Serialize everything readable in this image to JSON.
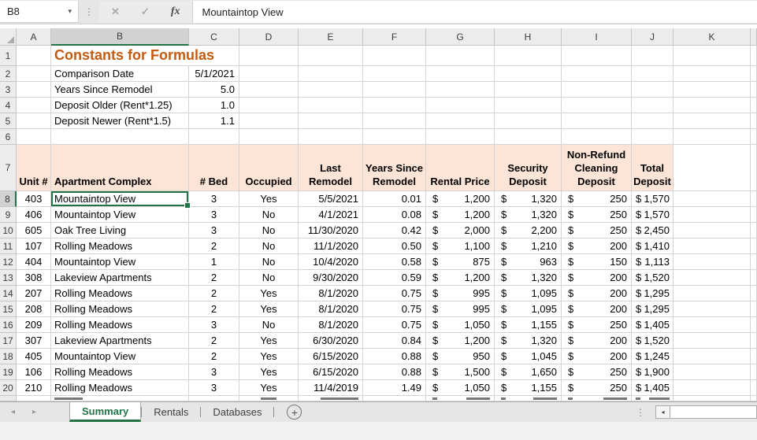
{
  "formula_bar": {
    "cell_reference": "B8",
    "formula": "Mountaintop View"
  },
  "icons": {
    "name_box_caret": "▾",
    "cancel": "✕",
    "confirm": "✓",
    "function": "fx",
    "tab_nav_left": "◂",
    "tab_nav_right": "▸",
    "add_sheet": "+",
    "more_dots": "⋮",
    "scroll_left": "◂"
  },
  "colors": {
    "accent_green": "#217346",
    "table_header_fill": "#FCE4D6",
    "title_text": "#C55A11",
    "chrome_gray": "#E6E6E6"
  },
  "column_headers": [
    "A",
    "B",
    "C",
    "D",
    "E",
    "F",
    "G",
    "H",
    "I",
    "J",
    "K"
  ],
  "selection": {
    "cell": "B8",
    "column": "B",
    "row": 8
  },
  "constants": {
    "title": "Constants for Formulas",
    "items": [
      {
        "row": 2,
        "label": "Comparison Date",
        "value": "5/1/2021"
      },
      {
        "row": 3,
        "label": "Years Since Remodel",
        "value": "5.0"
      },
      {
        "row": 4,
        "label": "Deposit Older (Rent*1.25)",
        "value": "1.0"
      },
      {
        "row": 5,
        "label": "Deposit Newer (Rent*1.5)",
        "value": "1.1"
      }
    ]
  },
  "table": {
    "header_row": 7,
    "headers": [
      "Unit #",
      "Apartment Complex",
      "# Bed",
      "Occupied",
      "Last Remodel",
      "Years Since Remodel",
      "Rental Price",
      "Security Deposit",
      "Non-Refund Cleaning Deposit",
      "Total Deposit"
    ],
    "currency_symbol": "$",
    "rows": [
      {
        "row": 8,
        "unit": "403",
        "complex": "Mountaintop View",
        "beds": "3",
        "occupied": "Yes",
        "last_remodel": "5/5/2021",
        "years_since": "0.01",
        "rental": "1,200",
        "security": "1,320",
        "cleaning": "250",
        "total": "1,570"
      },
      {
        "row": 9,
        "unit": "406",
        "complex": "Mountaintop View",
        "beds": "3",
        "occupied": "No",
        "last_remodel": "4/1/2021",
        "years_since": "0.08",
        "rental": "1,200",
        "security": "1,320",
        "cleaning": "250",
        "total": "1,570"
      },
      {
        "row": 10,
        "unit": "605",
        "complex": "Oak Tree Living",
        "beds": "3",
        "occupied": "No",
        "last_remodel": "11/30/2020",
        "years_since": "0.42",
        "rental": "2,000",
        "security": "2,200",
        "cleaning": "250",
        "total": "2,450"
      },
      {
        "row": 11,
        "unit": "107",
        "complex": "Rolling Meadows",
        "beds": "2",
        "occupied": "No",
        "last_remodel": "11/1/2020",
        "years_since": "0.50",
        "rental": "1,100",
        "security": "1,210",
        "cleaning": "200",
        "total": "1,410"
      },
      {
        "row": 12,
        "unit": "404",
        "complex": "Mountaintop View",
        "beds": "1",
        "occupied": "No",
        "last_remodel": "10/4/2020",
        "years_since": "0.58",
        "rental": "875",
        "security": "963",
        "cleaning": "150",
        "total": "1,113"
      },
      {
        "row": 13,
        "unit": "308",
        "complex": "Lakeview Apartments",
        "beds": "2",
        "occupied": "No",
        "last_remodel": "9/30/2020",
        "years_since": "0.59",
        "rental": "1,200",
        "security": "1,320",
        "cleaning": "200",
        "total": "1,520"
      },
      {
        "row": 14,
        "unit": "207",
        "complex": "Rolling Meadows",
        "beds": "2",
        "occupied": "Yes",
        "last_remodel": "8/1/2020",
        "years_since": "0.75",
        "rental": "995",
        "security": "1,095",
        "cleaning": "200",
        "total": "1,295"
      },
      {
        "row": 15,
        "unit": "208",
        "complex": "Rolling Meadows",
        "beds": "2",
        "occupied": "Yes",
        "last_remodel": "8/1/2020",
        "years_since": "0.75",
        "rental": "995",
        "security": "1,095",
        "cleaning": "200",
        "total": "1,295"
      },
      {
        "row": 16,
        "unit": "209",
        "complex": "Rolling Meadows",
        "beds": "3",
        "occupied": "No",
        "last_remodel": "8/1/2020",
        "years_since": "0.75",
        "rental": "1,050",
        "security": "1,155",
        "cleaning": "250",
        "total": "1,405"
      },
      {
        "row": 17,
        "unit": "307",
        "complex": "Lakeview Apartments",
        "beds": "2",
        "occupied": "Yes",
        "last_remodel": "6/30/2020",
        "years_since": "0.84",
        "rental": "1,200",
        "security": "1,320",
        "cleaning": "200",
        "total": "1,520"
      },
      {
        "row": 18,
        "unit": "405",
        "complex": "Mountaintop View",
        "beds": "2",
        "occupied": "Yes",
        "last_remodel": "6/15/2020",
        "years_since": "0.88",
        "rental": "950",
        "security": "1,045",
        "cleaning": "200",
        "total": "1,245"
      },
      {
        "row": 19,
        "unit": "106",
        "complex": "Rolling Meadows",
        "beds": "3",
        "occupied": "Yes",
        "last_remodel": "6/15/2020",
        "years_since": "0.88",
        "rental": "1,500",
        "security": "1,650",
        "cleaning": "250",
        "total": "1,900"
      },
      {
        "row": 20,
        "unit": "210",
        "complex": "Rolling Meadows",
        "beds": "3",
        "occupied": "Yes",
        "last_remodel": "11/4/2019",
        "years_since": "1.49",
        "rental": "1,050",
        "security": "1,155",
        "cleaning": "250",
        "total": "1,405"
      }
    ],
    "partial_row": {
      "row": 21,
      "clipped": true
    }
  },
  "sheet_tabs": {
    "tabs": [
      "Summary",
      "Rentals",
      "Databases"
    ],
    "active": "Summary"
  }
}
